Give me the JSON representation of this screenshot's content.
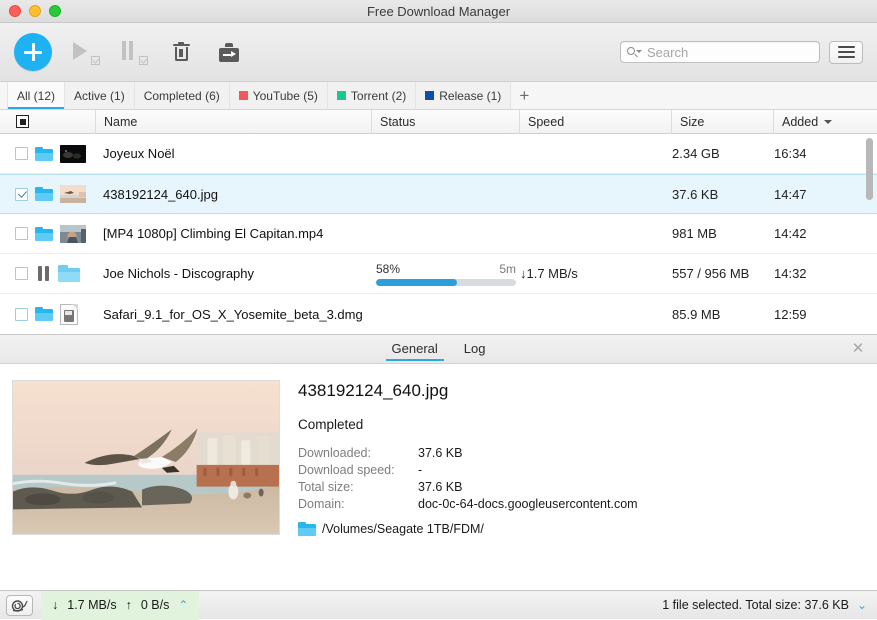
{
  "window": {
    "title": "Free Download Manager",
    "traffic_lights": [
      "close",
      "minimize",
      "zoom"
    ]
  },
  "toolbar": {
    "add_label": "+",
    "icons": [
      {
        "name": "add-download",
        "glyph": "plus"
      },
      {
        "name": "start-download",
        "glyph": "play"
      },
      {
        "name": "pause-download",
        "glyph": "pause"
      },
      {
        "name": "delete-download",
        "glyph": "trash"
      },
      {
        "name": "move-download",
        "glyph": "export"
      }
    ],
    "search": {
      "placeholder": "Search",
      "value": ""
    },
    "menu_label": "menu"
  },
  "filters": {
    "tabs": [
      {
        "label": "All (12)",
        "color": "",
        "active": true
      },
      {
        "label": "Active (1)",
        "color": "",
        "active": false
      },
      {
        "label": "Completed (6)",
        "color": "",
        "active": false
      },
      {
        "label": "YouTube (5)",
        "color": "#f2565f",
        "active": false
      },
      {
        "label": "Torrent (2)",
        "color": "#19c98b",
        "active": false
      },
      {
        "label": "Release (1)",
        "color": "#0c4fa8",
        "active": false
      }
    ],
    "add_label": "+"
  },
  "table": {
    "columns": [
      {
        "key": "check",
        "label": ""
      },
      {
        "key": "name",
        "label": "Name"
      },
      {
        "key": "status",
        "label": "Status"
      },
      {
        "key": "speed",
        "label": "Speed"
      },
      {
        "key": "size",
        "label": "Size"
      },
      {
        "key": "added",
        "label": "Added"
      }
    ],
    "sort_column": "Added",
    "rows": [
      {
        "checked": false,
        "state_icon": "folder",
        "thumb": "night",
        "name": "Joyeux Noël",
        "status": "",
        "progress": null,
        "eta": "",
        "speed": "",
        "size": "2.34 GB",
        "added": "16:34",
        "selected": false
      },
      {
        "checked": true,
        "state_icon": "folder",
        "thumb": "seagull",
        "name": "438192124_640.jpg",
        "status": "",
        "progress": null,
        "eta": "",
        "speed": "",
        "size": "37.6 KB",
        "added": "14:47",
        "selected": true
      },
      {
        "checked": false,
        "state_icon": "folder",
        "thumb": "climber",
        "name": "[MP4 1080p] Climbing El Capitan.mp4",
        "status": "",
        "progress": null,
        "eta": "",
        "speed": "",
        "size": "981 MB",
        "added": "14:42",
        "selected": false
      },
      {
        "checked": false,
        "state_icon": "pause",
        "thumb": "folder-light",
        "name": "Joe Nichols - Discography",
        "status": "58%",
        "progress": 58,
        "eta": "5m",
        "speed": "↓1.7 MB/s",
        "size": "557 / 956 MB",
        "added": "14:32",
        "selected": false
      },
      {
        "checked": false,
        "state_icon": "folder",
        "thumb": "dmg",
        "name": "Safari_9.1_for_OS_X_Yosemite_beta_3.dmg",
        "status": "",
        "progress": null,
        "eta": "",
        "speed": "",
        "size": "85.9 MB",
        "added": "12:59",
        "selected": false
      }
    ]
  },
  "detail": {
    "tabs": [
      {
        "label": "General",
        "active": true
      },
      {
        "label": "Log",
        "active": false
      }
    ],
    "close_label": "✕",
    "title": "438192124_640.jpg",
    "status": "Completed",
    "fields": [
      {
        "key": "Downloaded:",
        "value": "37.6 KB"
      },
      {
        "key": "Download speed:",
        "value": "-"
      },
      {
        "key": "Total size:",
        "value": "37.6 KB"
      },
      {
        "key": "Domain:",
        "value": "doc-0c-64-docs.googleusercontent.com"
      }
    ],
    "path": "/Volumes/Seagate 1TB/FDM/"
  },
  "statusbar": {
    "snail_label": "speed-limit",
    "download_speed": "1.7 MB/s",
    "upload_speed": "0 B/s",
    "down_arrow": "↓",
    "up_arrow": "↑",
    "expand_up": "⌃",
    "selection_text": "1 file selected. Total size: 37.6 KB",
    "expand_down": "⌄"
  },
  "colors": {
    "accent": "#2ea8e0",
    "add_button": "#1eb2f3",
    "progress": "#2a9fd8",
    "selected_row": "#e7f6fc",
    "speed_panel": "#e2f3dd"
  }
}
